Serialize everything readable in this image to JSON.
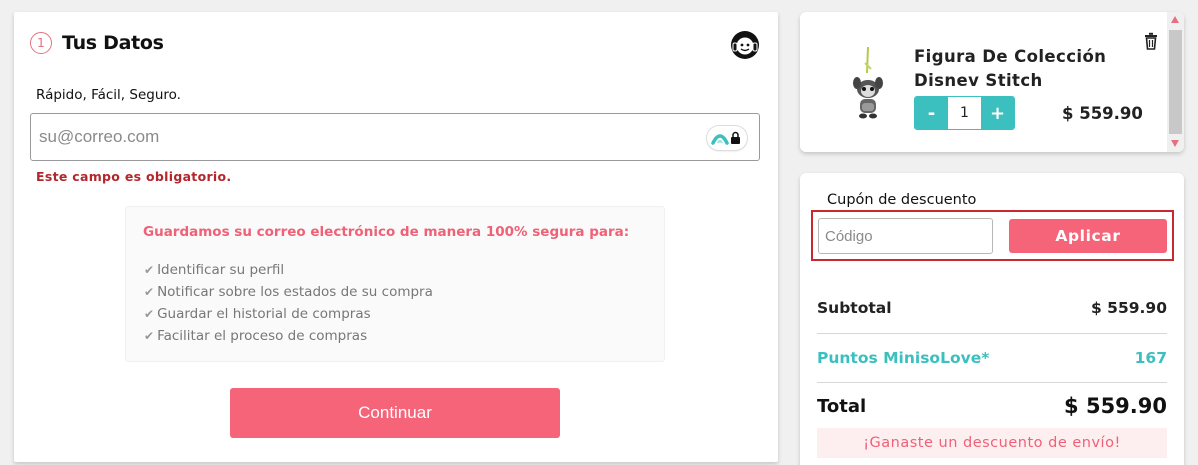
{
  "form": {
    "step_number": "1",
    "title": "Tus Datos",
    "subtitle": "Rápido, Fácil, Seguro.",
    "email_placeholder": "su@correo.com",
    "email_value": "",
    "error": "Este campo es obligatorio.",
    "info": {
      "heading": "Guardamos su correo electrónico de manera 100% segura para:",
      "items": [
        "Identificar su perfil",
        "Notificar sobre los estados de su compra",
        "Guardar el historial de compras",
        "Facilitar el proceso de compras"
      ]
    },
    "continue_label": "Continuar"
  },
  "cart_item": {
    "name": "Figura De Colección Disnev Stitch",
    "quantity": "1",
    "minus": "-",
    "plus": "+",
    "price": "$ 559.90"
  },
  "summary": {
    "coupon_label": "Cupón de descuento",
    "coupon_placeholder": "Código",
    "apply_label": "Aplicar",
    "subtotal_label": "Subtotal",
    "subtotal_value": "$ 559.90",
    "points_label": "Puntos MinisoLove*",
    "points_value": "167",
    "total_label": "Total",
    "total_value": "$ 559.90",
    "promo": "¡Ganaste un descuento de envío!"
  },
  "colors": {
    "brand_pink": "#f56479",
    "teal": "#3bbfbf",
    "error_red": "#b3262c",
    "highlight_frame": "#c9282f"
  },
  "icons": {
    "help": "support-headset-icon",
    "password_manager": "password-manager-icon",
    "check": "check-icon",
    "trash": "trash-icon"
  }
}
